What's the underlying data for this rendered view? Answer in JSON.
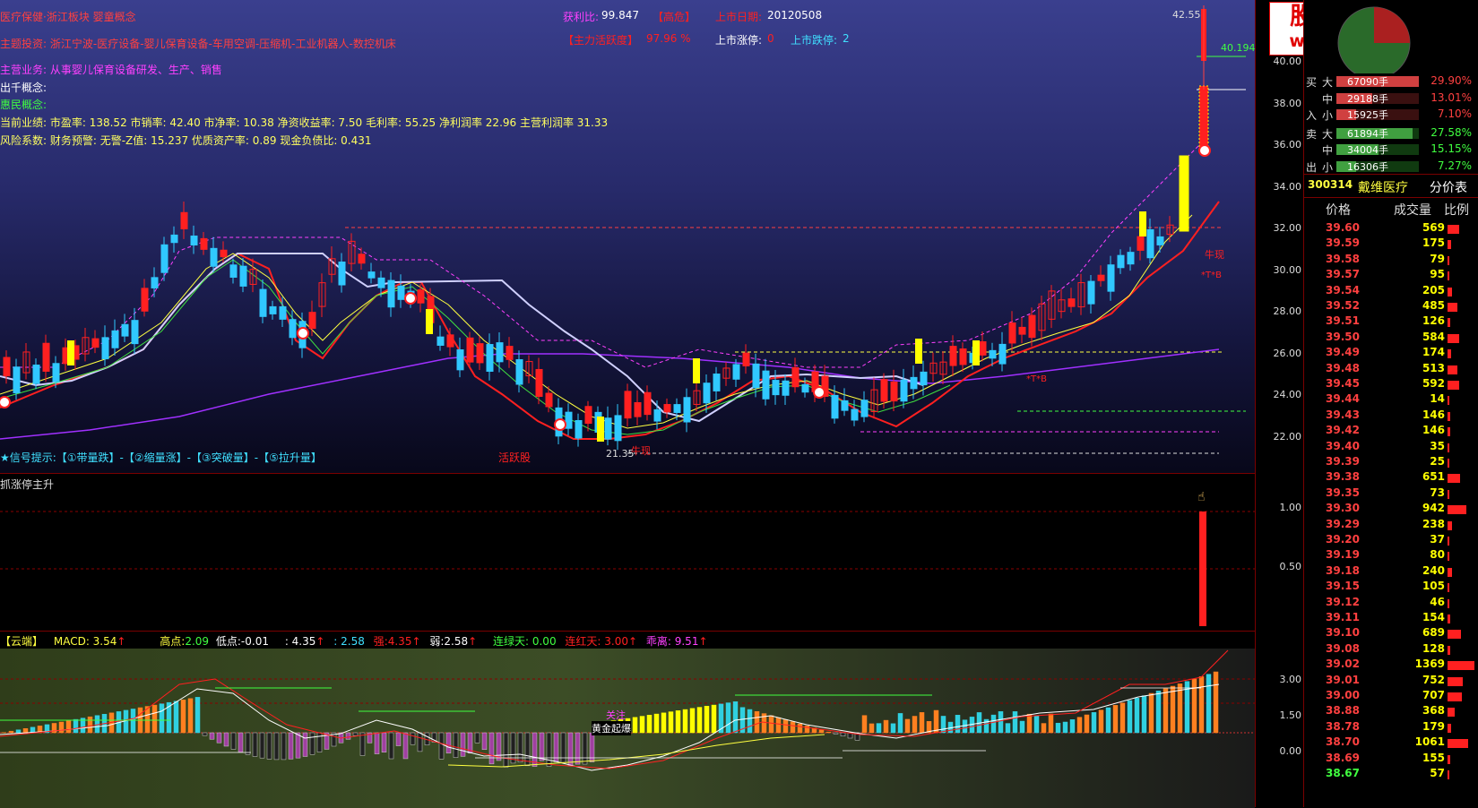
{
  "top_info": {
    "concept": "医疗保健·浙江板块 婴童概念",
    "theme": "主题投资: 浙江宁波-医疗设备-婴儿保育设备-车用空调-压缩机-工业机器人-数控机床",
    "business": "主营业务: 从事婴儿保育设备研发、生产、销售",
    "out_concept": "出千概念:",
    "people_concept": "惠民概念:",
    "performance": "当前业绩: 市盈率: 138.52 市销率: 42.40 市净率: 10.38 净资收益率: 7.50 毛利率: 55.25 净利润率 22.96 主营利润率 31.33",
    "risk": "风险系数: 财务预警: 无警-Z值: 15.237 优质资产率: 0.89 现金负债比: 0.431"
  },
  "header_stats": {
    "profit_label": "获利比:",
    "profit_value": "99.847",
    "risk_badge": "【高危】",
    "list_date_label": "上市日期:",
    "list_date_value": "20120508",
    "activity_label": "【主力活跃度】",
    "activity_value": "97.96 %",
    "limit_up_label": "上市涨停:",
    "limit_up_value": "0",
    "limit_down_label": "上市跌停:",
    "limit_down_value": "2"
  },
  "price_labels": {
    "high": "42.55",
    "right": "40.194",
    "low": "21.35"
  },
  "annotations": {
    "active_stock": "活跃股",
    "niu_xian_1": "牛现",
    "niu_xian_2": "牛现",
    "tb_1": "*T*B",
    "tb_2": "*T*B"
  },
  "signal_hint": "★信号提示:【①带量跌】-【②缩量涨】-【③突破量】-【⑤拉升量】",
  "mid_pane": {
    "title": "抓涨停主升",
    "y_ticks": [
      "1.00",
      "0.50"
    ]
  },
  "macd_pane": {
    "name": "【云端】",
    "macd": "MACD: 3.54",
    "high_label": "高点:",
    "high_value": "2.09",
    "low_label": "低点:",
    "low_value": "-0.01",
    "v3": ": 4.35",
    "v4": ": 2.58",
    "strong_label": "强:",
    "strong_value": "4.35",
    "weak_label": "弱:",
    "weak_value": "2.58",
    "green_days": "连绿天: 0.00",
    "red_days": "连红天: 3.00",
    "divergence": "乖离: 9.51",
    "y_ticks": [
      "3.00",
      "1.50",
      "0.00"
    ],
    "tag_gold": "黄金起爆",
    "tag_attention": "关注"
  },
  "price_axis": [
    "40.00",
    "38.00",
    "36.00",
    "34.00",
    "32.00",
    "30.00",
    "28.00",
    "26.00",
    "24.00",
    "22.00"
  ],
  "logo": {
    "title": "股票公式指标网",
    "url": "www.gsxz.com.cn"
  },
  "order_flow": {
    "buy": [
      {
        "side": "买",
        "size": "大",
        "amount": "67090手",
        "pct": "29.90%",
        "ratio": 0.299
      },
      {
        "side": "",
        "size": "中",
        "amount": "29188手",
        "pct": "13.01%",
        "ratio": 0.13
      },
      {
        "side": "入",
        "size": "小",
        "amount": "15925手",
        "pct": "7.10%",
        "ratio": 0.071
      }
    ],
    "sell": [
      {
        "side": "卖",
        "size": "大",
        "amount": "61894手",
        "pct": "27.58%",
        "ratio": 0.276
      },
      {
        "side": "",
        "size": "中",
        "amount": "34004手",
        "pct": "15.15%",
        "ratio": 0.152
      },
      {
        "side": "出",
        "size": "小",
        "amount": "16306手",
        "pct": "7.27%",
        "ratio": 0.073
      }
    ]
  },
  "stock": {
    "code": "300314",
    "name": "戴维医疗",
    "table_name": "分价表"
  },
  "price_table": {
    "headers": [
      "价格",
      "成交量",
      "比例"
    ],
    "rows": [
      {
        "price": "39.60",
        "vol": "569",
        "r": 0.42
      },
      {
        "price": "39.59",
        "vol": "175",
        "r": 0.13
      },
      {
        "price": "39.58",
        "vol": "79",
        "r": 0.06
      },
      {
        "price": "39.57",
        "vol": "95",
        "r": 0.07
      },
      {
        "price": "39.54",
        "vol": "205",
        "r": 0.15
      },
      {
        "price": "39.52",
        "vol": "485",
        "r": 0.35
      },
      {
        "price": "39.51",
        "vol": "126",
        "r": 0.09
      },
      {
        "price": "39.50",
        "vol": "584",
        "r": 0.43
      },
      {
        "price": "39.49",
        "vol": "174",
        "r": 0.13
      },
      {
        "price": "39.48",
        "vol": "513",
        "r": 0.37
      },
      {
        "price": "39.45",
        "vol": "592",
        "r": 0.43
      },
      {
        "price": "39.44",
        "vol": "14",
        "r": 0.01
      },
      {
        "price": "39.43",
        "vol": "146",
        "r": 0.11
      },
      {
        "price": "39.42",
        "vol": "146",
        "r": 0.11
      },
      {
        "price": "39.40",
        "vol": "35",
        "r": 0.03
      },
      {
        "price": "39.39",
        "vol": "25",
        "r": 0.02
      },
      {
        "price": "39.38",
        "vol": "651",
        "r": 0.48
      },
      {
        "price": "39.35",
        "vol": "73",
        "r": 0.05
      },
      {
        "price": "39.30",
        "vol": "942",
        "r": 0.69
      },
      {
        "price": "39.29",
        "vol": "238",
        "r": 0.17
      },
      {
        "price": "39.20",
        "vol": "37",
        "r": 0.03
      },
      {
        "price": "39.19",
        "vol": "80",
        "r": 0.06
      },
      {
        "price": "39.18",
        "vol": "240",
        "r": 0.18
      },
      {
        "price": "39.15",
        "vol": "105",
        "r": 0.08
      },
      {
        "price": "39.12",
        "vol": "46",
        "r": 0.03
      },
      {
        "price": "39.11",
        "vol": "154",
        "r": 0.11
      },
      {
        "price": "39.10",
        "vol": "689",
        "r": 0.5
      },
      {
        "price": "39.08",
        "vol": "128",
        "r": 0.09
      },
      {
        "price": "39.02",
        "vol": "1369",
        "r": 1.0
      },
      {
        "price": "39.01",
        "vol": "752",
        "r": 0.55
      },
      {
        "price": "39.00",
        "vol": "707",
        "r": 0.52
      },
      {
        "price": "38.88",
        "vol": "368",
        "r": 0.27
      },
      {
        "price": "38.78",
        "vol": "179",
        "r": 0.13
      },
      {
        "price": "38.70",
        "vol": "1061",
        "r": 0.78
      },
      {
        "price": "38.69",
        "vol": "155",
        "r": 0.11
      },
      {
        "price": "38.67",
        "vol": "57",
        "r": 0.04
      }
    ]
  }
}
